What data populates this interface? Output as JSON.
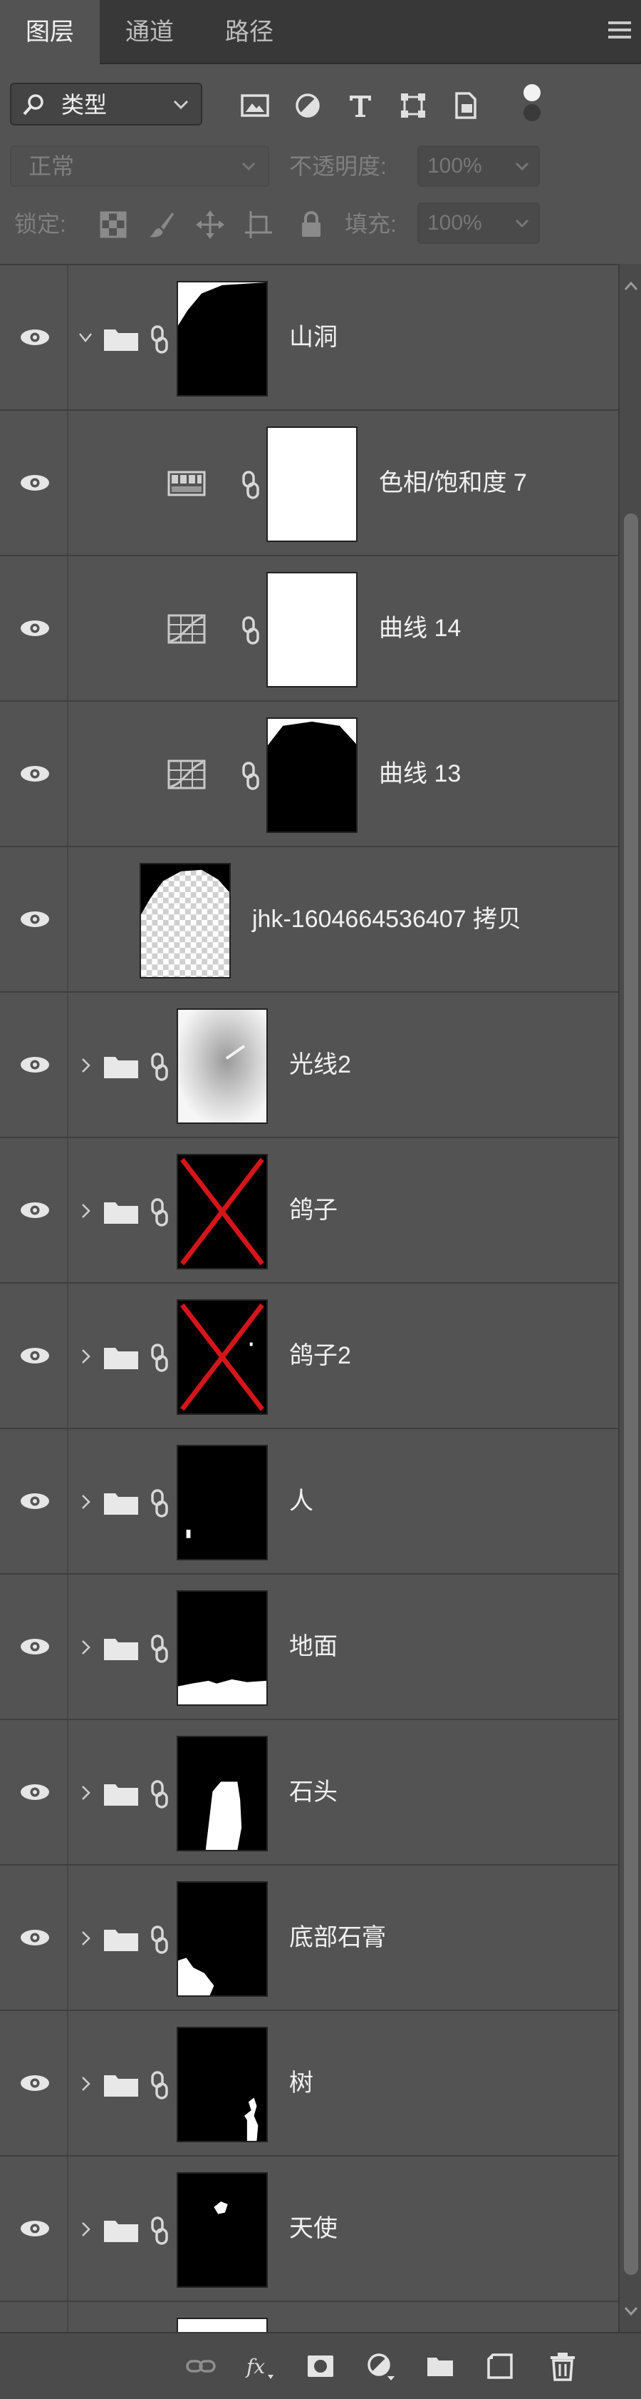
{
  "tabs": [
    {
      "label": "图层",
      "active": true
    },
    {
      "label": "通道",
      "active": false
    },
    {
      "label": "路径",
      "active": false
    }
  ],
  "filter": {
    "kind_label": "类型",
    "icons": [
      "image-filter-icon",
      "adjustment-filter-icon",
      "type-filter-icon",
      "shape-filter-icon",
      "smart-object-filter-icon",
      "filter-toggle-icon"
    ]
  },
  "blend": {
    "mode": "正常",
    "opacity_label": "不透明度:",
    "opacity_value": "100%"
  },
  "lock": {
    "label": "锁定:",
    "icons": [
      "lock-transparent-pixels-icon",
      "lock-image-pixels-icon",
      "lock-position-icon",
      "lock-artboard-icon",
      "lock-all-icon"
    ],
    "fill_label": "填充:",
    "fill_value": "100%"
  },
  "layers": [
    {
      "name": "山洞",
      "kind": "group",
      "expanded": true,
      "thumb": "cave-mask"
    },
    {
      "name": "色相/饱和度 7",
      "kind": "adjustment",
      "adjust": "hue-saturation",
      "thumb": "white"
    },
    {
      "name": "曲线 14",
      "kind": "adjustment",
      "adjust": "curves",
      "thumb": "white"
    },
    {
      "name": "曲线 13",
      "kind": "adjustment",
      "adjust": "curves",
      "thumb": "arch-mask"
    },
    {
      "name": "jhk-1604664536407 拷贝",
      "kind": "pixel",
      "thumb": "checker-white"
    },
    {
      "name": "光线2",
      "kind": "group",
      "expanded": false,
      "thumb": "light-glow"
    },
    {
      "name": "鸽子",
      "kind": "group",
      "expanded": false,
      "thumb": "red-cross"
    },
    {
      "name": "鸽子2",
      "kind": "group",
      "expanded": false,
      "thumb": "red-cross-dot"
    },
    {
      "name": "人",
      "kind": "group",
      "expanded": false,
      "thumb": "person-dot"
    },
    {
      "name": "地面",
      "kind": "group",
      "expanded": false,
      "thumb": "ground"
    },
    {
      "name": "石头",
      "kind": "group",
      "expanded": false,
      "thumb": "stone"
    },
    {
      "name": "底部石膏",
      "kind": "group",
      "expanded": false,
      "thumb": "plaster"
    },
    {
      "name": "树",
      "kind": "group",
      "expanded": false,
      "thumb": "tree"
    },
    {
      "name": "天使",
      "kind": "group",
      "expanded": false,
      "thumb": "angel"
    },
    {
      "name": "",
      "kind": "group",
      "expanded": false,
      "thumb": "partial-white"
    }
  ],
  "bottom_toolbar": [
    "link-layers-icon",
    "layer-style-icon",
    "add-mask-icon",
    "new-adjustment-icon",
    "new-group-icon",
    "new-layer-icon",
    "delete-layer-icon"
  ],
  "colors": {
    "panel": "#535353",
    "tabbar": "#383838",
    "cross": "#d4161b"
  }
}
